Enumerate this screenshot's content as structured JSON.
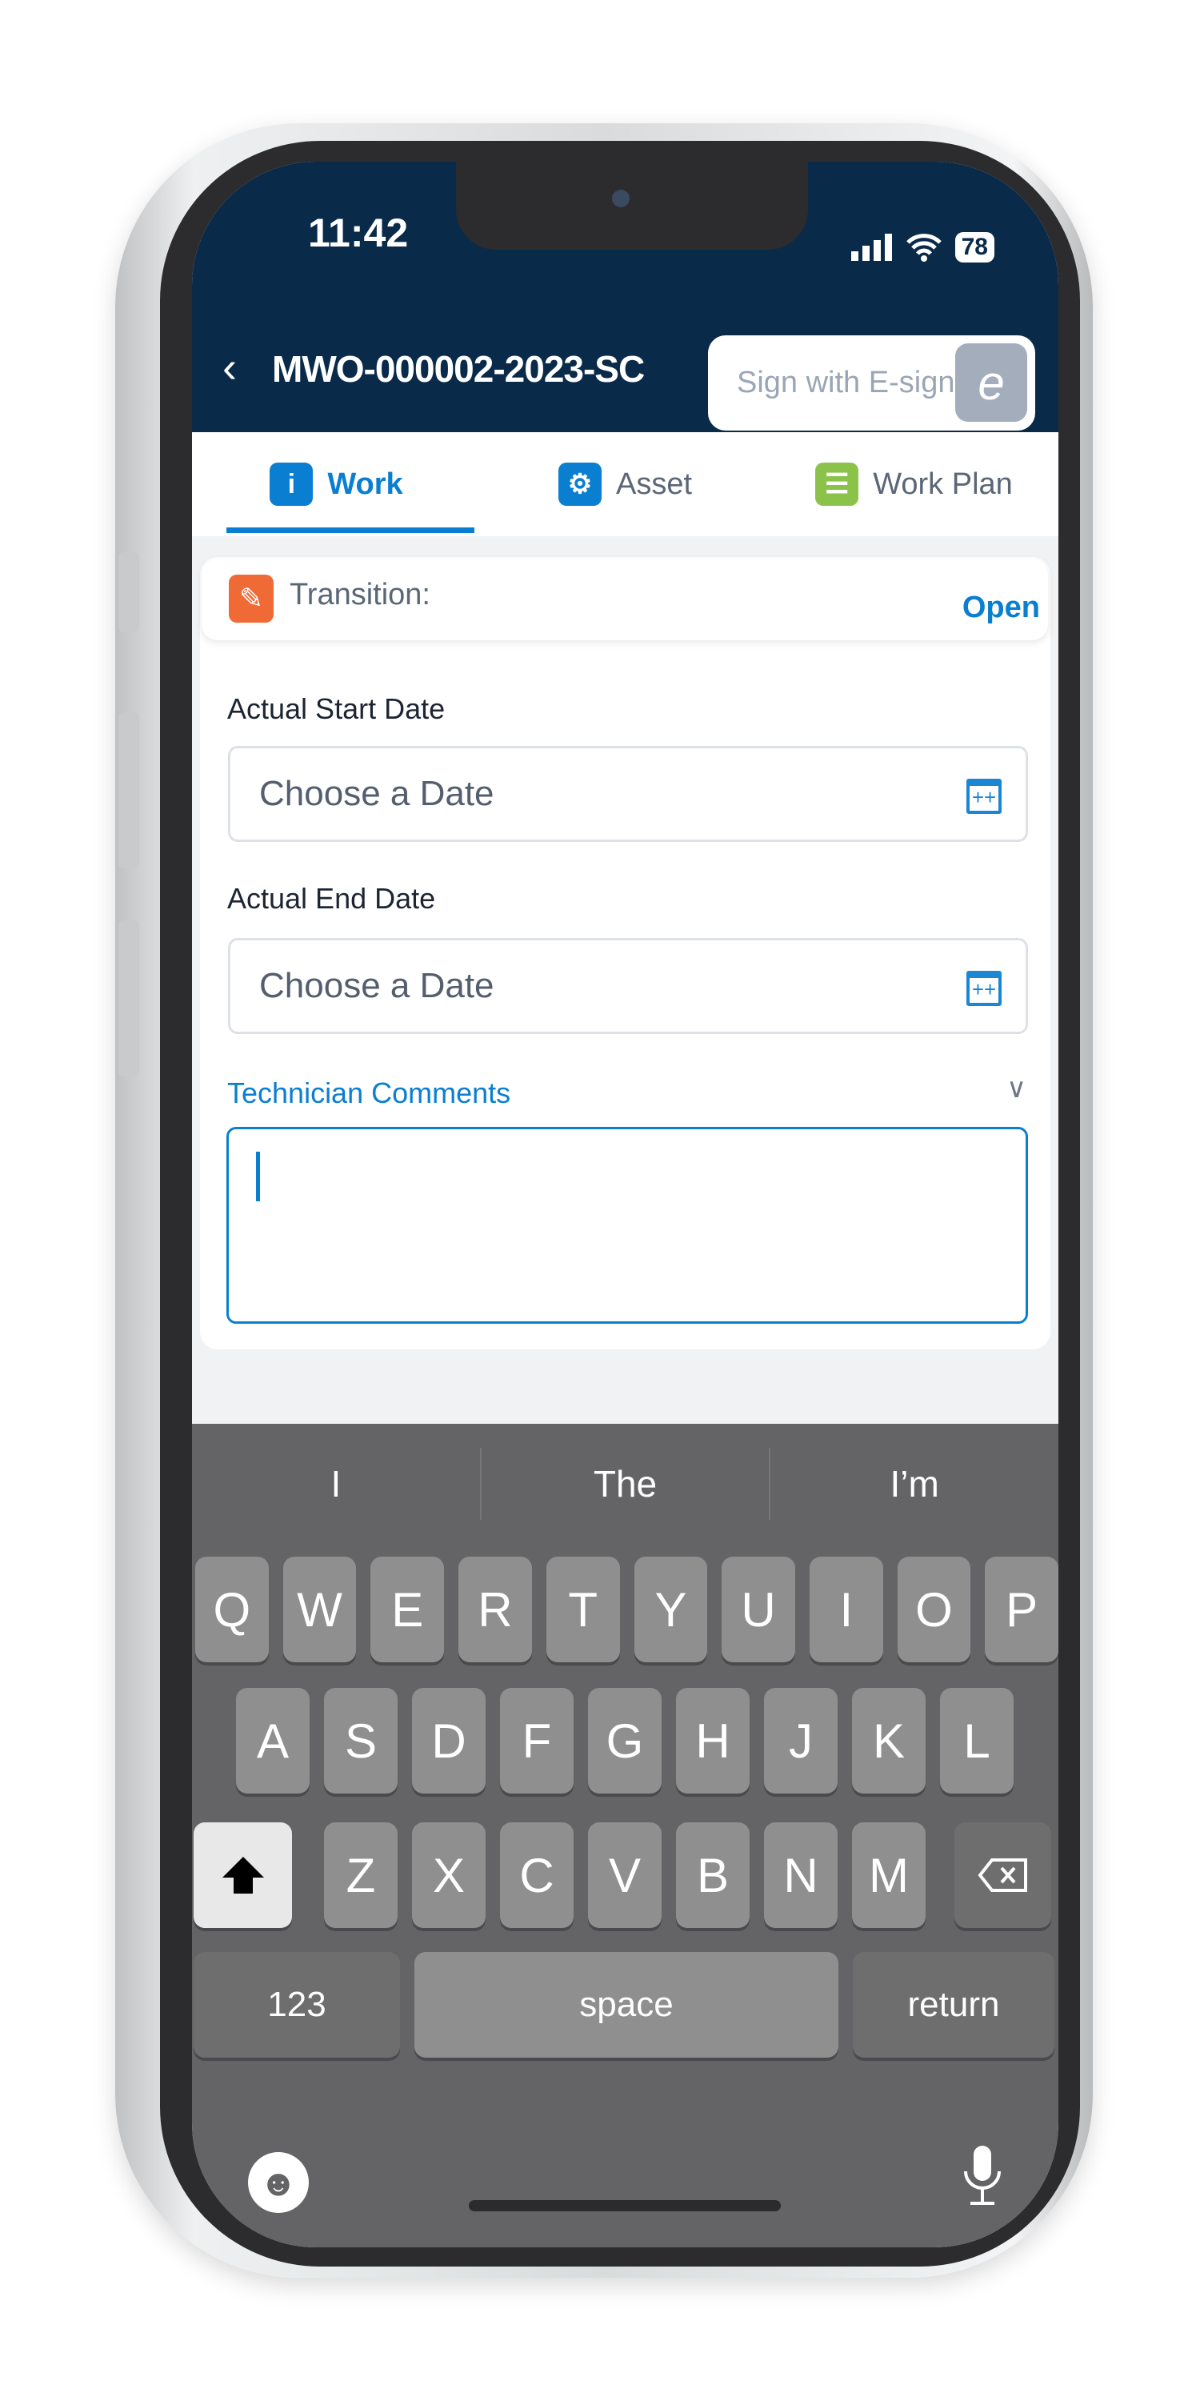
{
  "status_bar": {
    "time": "11:42",
    "battery": "78",
    "icons": [
      "signal-icon",
      "wifi-icon",
      "battery-icon"
    ]
  },
  "header": {
    "title": "MWO-000002-2023-SC",
    "back_icon": "chevron-left-icon",
    "esign_label": "Sign with E-sign",
    "esign_icon": "e"
  },
  "tabs": [
    {
      "label": "Work",
      "icon": "i",
      "color": "#0a7fd1",
      "active": true
    },
    {
      "label": "Asset",
      "icon": "⚙",
      "color": "#0a7fd1",
      "active": false
    },
    {
      "label": "Work Plan",
      "icon": "☰",
      "color": "#8bc34a",
      "active": false
    }
  ],
  "transition": {
    "label": "Transition:",
    "value": "Open"
  },
  "form": {
    "start_label": "Actual Start Date",
    "start_placeholder": "Choose a Date",
    "end_label": "Actual End Date",
    "end_placeholder": "Choose a Date",
    "comments_label": "Technician Comments",
    "comments_value": ""
  },
  "keyboard": {
    "suggestions": [
      "I",
      "The",
      "I’m"
    ],
    "row1": [
      "Q",
      "W",
      "E",
      "R",
      "T",
      "Y",
      "U",
      "I",
      "O",
      "P"
    ],
    "row2": [
      "A",
      "S",
      "D",
      "F",
      "G",
      "H",
      "J",
      "K",
      "L"
    ],
    "row3": [
      "Z",
      "X",
      "C",
      "V",
      "B",
      "N",
      "M"
    ],
    "numbers": "123",
    "space": "space",
    "return": "return"
  }
}
